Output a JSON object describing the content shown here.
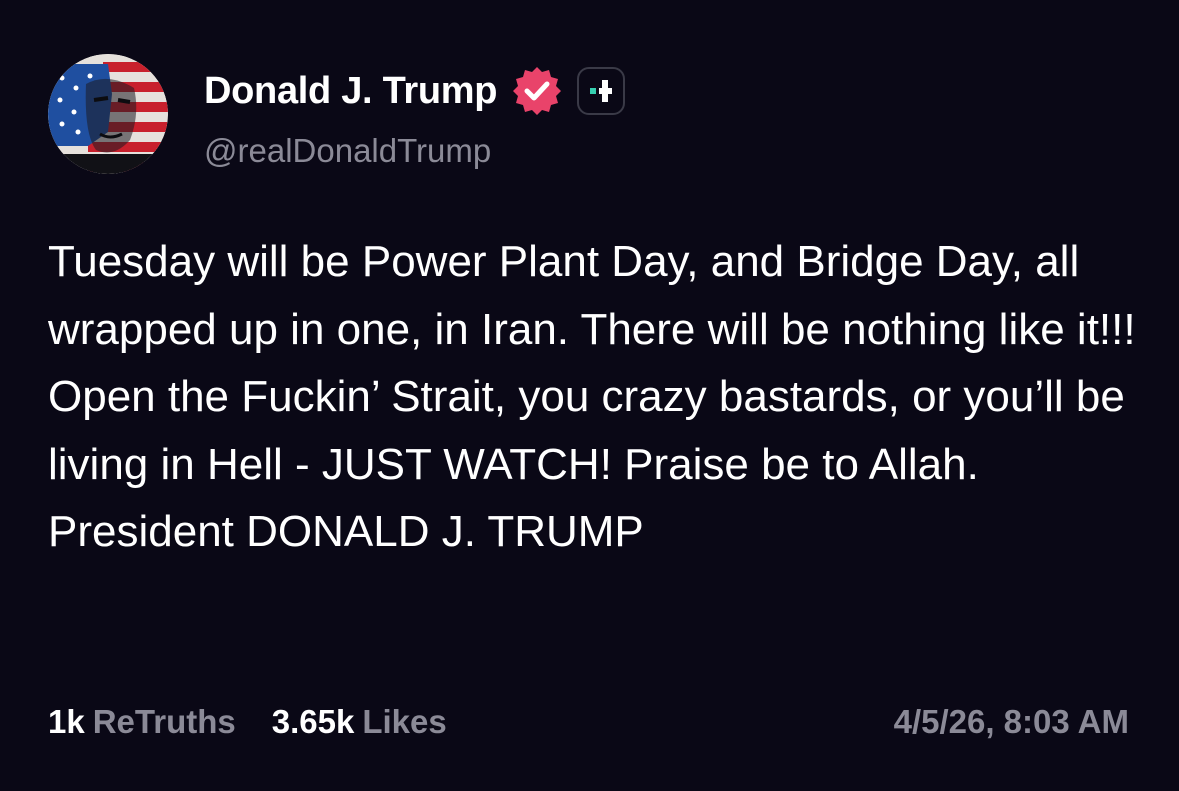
{
  "post": {
    "author": {
      "display_name": "Donald J. Trump",
      "handle": "@realDonaldTrump",
      "verified": true
    },
    "text": "Tuesday will be Power Plant Day, and Bridge Day, all wrapped up in one, in Iran. There will be nothing like it!!! Open the Fuckin’ Strait, you crazy bastards, or you’ll be living in Hell - JUST WATCH! Praise be to Allah. President DONALD J. TRUMP",
    "stats": {
      "retruths_count": "1k",
      "retruths_label": "ReTruths",
      "likes_count": "3.65k",
      "likes_label": "Likes"
    },
    "timestamp": "4/5/26, 8:03 AM"
  },
  "icons": {
    "verified": "verified-badge-icon",
    "plus": "plus-subscription-icon"
  },
  "colors": {
    "background": "#0a0816",
    "verified_badge": "#e9436a",
    "plus_accent": "#36d0b1",
    "muted_text": "#8b8a97"
  }
}
